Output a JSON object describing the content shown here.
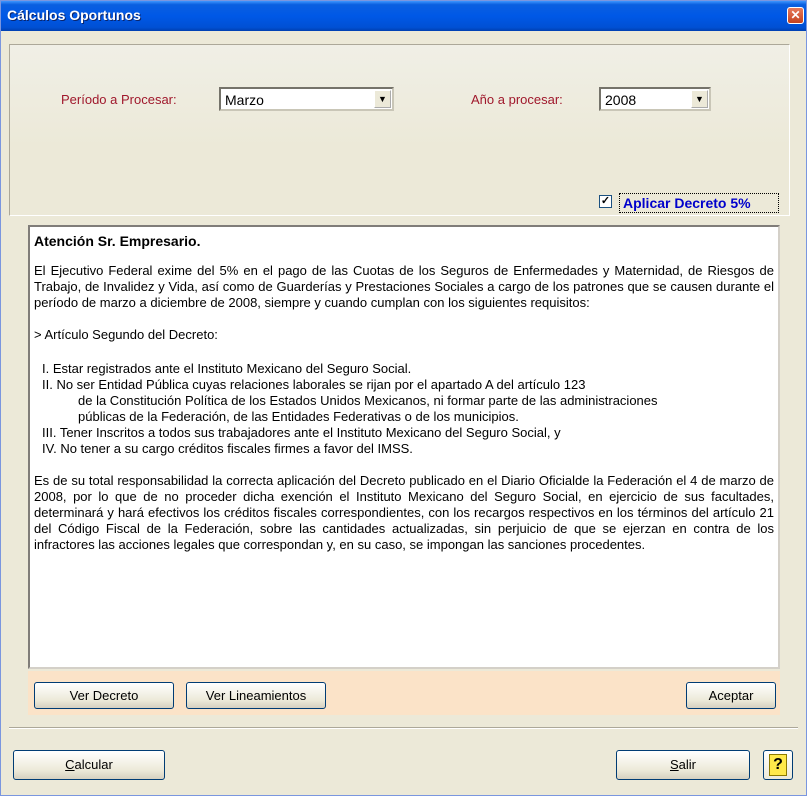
{
  "window": {
    "title": "Cálculos Oportunos",
    "close_symbol": "✕"
  },
  "filters": {
    "period_label": "Período a Procesar:",
    "period_value": "Marzo",
    "year_label": "Año a procesar:",
    "year_value": "2008",
    "dropdown_arrow": "▼",
    "apply_decree_label": "Aplicar Decreto 5%",
    "apply_decree_checked": true,
    "check_mark": "✓"
  },
  "notice": {
    "heading": "Atención Sr. Empresario.",
    "intro": "El Ejecutivo Federal exime del 5% en  el pago de las Cuotas de los Seguros de Enfermedades y Maternidad,  de Riesgos de Trabajo, de Invalidez y Vida, así como de Guarderías y Prestaciones Sociales a cargo de los patrones que se causen durante el período de marzo a diciembre de 2008, siempre y cuando cumplan con los siguientes requisitos:",
    "article_heading": ">  Artículo Segundo del Decreto:",
    "requirements": [
      "I.  Estar registrados ante el Instituto Mexicano del Seguro Social.",
      "II. No ser Entidad Pública cuyas relaciones laborales se rijan por el apartado A del artículo 123",
      "de la Constitución Política de los Estados Unidos Mexicanos, ni formar parte de las administraciones",
      "públicas de la Federación, de las Entidades Federativas o de los municipios.",
      "III. Tener Inscritos a todos sus trabajadores ante el Instituto Mexicano del Seguro Social, y",
      "IV. No tener a su cargo créditos fiscales firmes a favor del IMSS."
    ],
    "closing": "Es de su total responsabilidad la correcta aplicación del Decreto publicado en el Diario Oficialde la Federación el 4 de marzo de 2008, por lo que de no proceder dicha exención el Instituto Mexicano del Seguro Social, en ejercicio de sus facultades, determinará y hará efectivos los créditos fiscales correspondientes, con los recargos respectivos en los términos del artículo 21 del Código Fiscal de la Federación, sobre las cantidades actualizadas, sin perjuicio de que se ejerzan en contra de los infractores las acciones legales que correspondan y, en su caso, se impongan las sanciones procedentes."
  },
  "notice_buttons": {
    "ver_decreto": "Ver Decreto",
    "ver_lineamientos": "Ver Lineamientos",
    "aceptar": "Aceptar"
  },
  "footer": {
    "calcular_mnemonic": "C",
    "calcular_rest": "alcular",
    "salir_mnemonic": "S",
    "salir_rest": "alir",
    "help_symbol": "?"
  },
  "colors": {
    "title_bar": "#0058e6",
    "red_label": "#a0182c",
    "blue_label": "#0000cc",
    "button_strip": "#fbe3c8"
  }
}
